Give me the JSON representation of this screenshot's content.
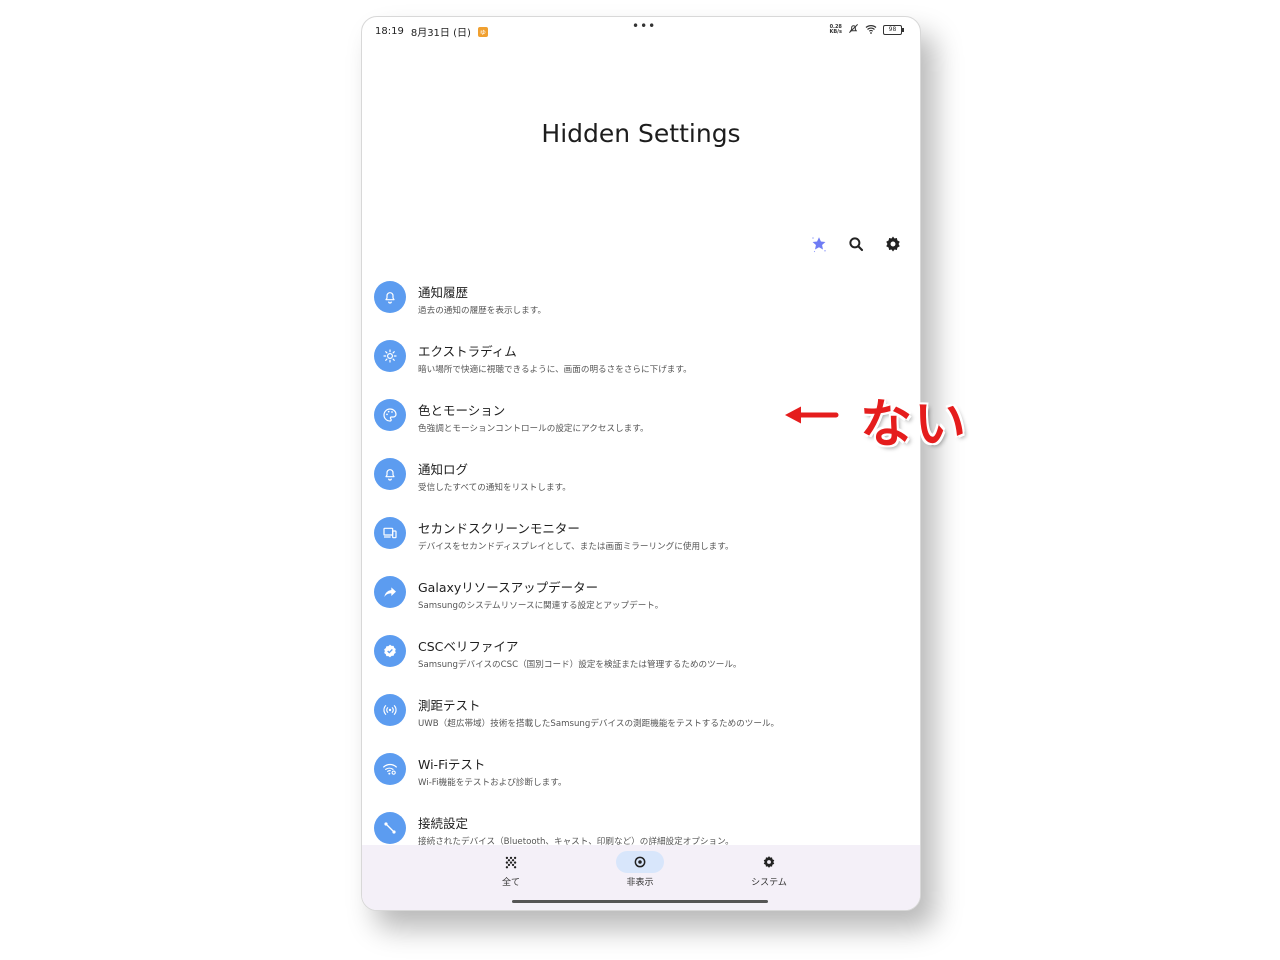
{
  "status_bar": {
    "time": "18:19",
    "date": "8月31日 (日)",
    "notif_badge": "ゅ",
    "dots": "•••",
    "net_speed_top": "0.28",
    "net_speed_bottom": "KB/s",
    "battery": "98"
  },
  "page": {
    "title": "Hidden Settings"
  },
  "toolbar": {
    "icons": [
      "star-sparkle-icon",
      "search-icon",
      "gear-icon"
    ]
  },
  "items": [
    {
      "title": "通知履歴",
      "subtitle": "過去の通知の履歴を表示します。",
      "icon": "bell-icon"
    },
    {
      "title": "エクストラディム",
      "subtitle": "暗い場所で快適に視聴できるように、画面の明るさをさらに下げます。",
      "icon": "sun-icon"
    },
    {
      "title": "色とモーション",
      "subtitle": "色強調とモーションコントロールの設定にアクセスします。",
      "icon": "palette-icon"
    },
    {
      "title": "通知ログ",
      "subtitle": "受信したすべての通知をリストします。",
      "icon": "bell-icon"
    },
    {
      "title": "セカンドスクリーンモニター",
      "subtitle": "デバイスをセカンドディスプレイとして、または画面ミラーリングに使用します。",
      "icon": "devices-icon"
    },
    {
      "title": "Galaxyリソースアップデーター",
      "subtitle": "Samsungのシステムリソースに関連する設定とアップデート。",
      "icon": "share-arrow-icon"
    },
    {
      "title": "CSCベリファイア",
      "subtitle": "SamsungデバイスのCSC（国別コード）設定を検証または管理するためのツール。",
      "icon": "verified-badge-icon"
    },
    {
      "title": "測距テスト",
      "subtitle": "UWB（超広帯域）技術を搭載したSamsungデバイスの測距機能をテストするためのツール。",
      "icon": "radar-icon"
    },
    {
      "title": "Wi-Fiテスト",
      "subtitle": "Wi-Fi機能をテストおよび診断します。",
      "icon": "wifi-settings-icon"
    },
    {
      "title": "接続設定",
      "subtitle": "接続されたデバイス（Bluetooth、キャスト、印刷など）の詳細設定オプション。",
      "icon": "connection-icon"
    }
  ],
  "bottom_nav": [
    {
      "label": "全て",
      "icon": "grid-dots-icon",
      "active": false
    },
    {
      "label": "非表示",
      "icon": "target-icon",
      "active": true
    },
    {
      "label": "システム",
      "icon": "gear-icon",
      "active": false
    }
  ],
  "annotation": {
    "text": "ない",
    "color": "#e51d1d"
  },
  "colors": {
    "accent": "#5c9cf0",
    "nav_bg": "#f4f0f8",
    "nav_active": "#d8e6fb"
  }
}
